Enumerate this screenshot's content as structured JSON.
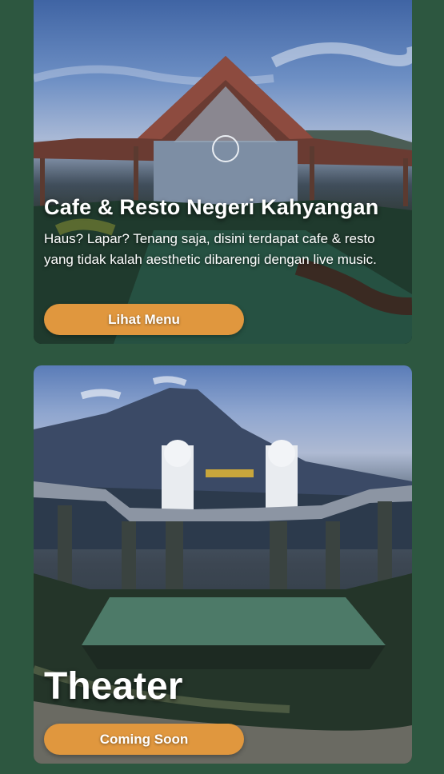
{
  "cards": [
    {
      "title": "Cafe & Resto Negeri Kahyangan",
      "description": "Haus? Lapar? Tenang saja, disini terdapat cafe & resto yang tidak kalah aesthetic dibarengi dengan live music.",
      "button_label": "Lihat Menu"
    },
    {
      "title": "Theater",
      "button_label": "Coming Soon"
    }
  ],
  "colors": {
    "page_background": "#2d5740",
    "button_background": "#e0973e",
    "text": "#ffffff"
  }
}
